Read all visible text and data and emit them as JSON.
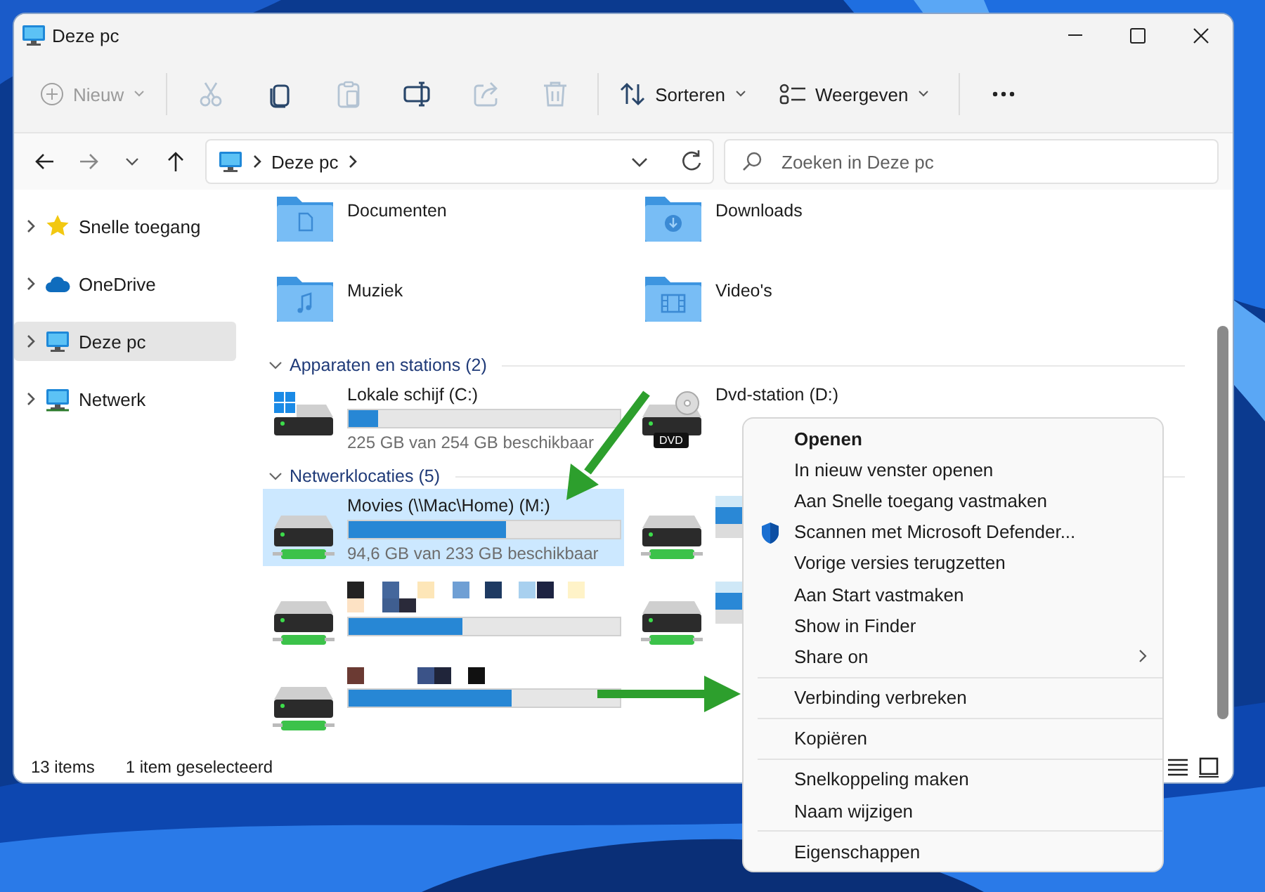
{
  "window": {
    "title": "Deze pc"
  },
  "toolbar": {
    "new": {
      "label": "Nieuw",
      "disabled": true
    },
    "tools": [
      {
        "kind": "cut",
        "disabled": true
      },
      {
        "kind": "copy",
        "disabled": false
      },
      {
        "kind": "paste",
        "disabled": true
      },
      {
        "kind": "rename",
        "disabled": false
      },
      {
        "kind": "share",
        "disabled": true
      },
      {
        "kind": "delete",
        "disabled": true
      }
    ],
    "menus": [
      {
        "kind": "sort",
        "label": "Sorteren"
      },
      {
        "kind": "view",
        "label": "Weergeven"
      }
    ]
  },
  "address_bar": {
    "path": [
      "Deze pc"
    ]
  },
  "search": {
    "placeholder": "Zoeken in Deze pc"
  },
  "sidebar": {
    "items": [
      {
        "kind": "star",
        "label": "Snelle toegang",
        "selected": false
      },
      {
        "kind": "cloud",
        "label": "OneDrive",
        "selected": false
      },
      {
        "kind": "pc",
        "label": "Deze pc",
        "selected": true
      },
      {
        "kind": "network",
        "label": "Netwerk",
        "selected": false
      }
    ]
  },
  "folders": [
    {
      "kind": "documents",
      "name": "Documenten"
    },
    {
      "kind": "downloads",
      "name": "Downloads"
    },
    {
      "kind": "music",
      "name": "Muziek"
    },
    {
      "kind": "videos",
      "name": "Video's"
    }
  ],
  "sections": [
    {
      "title": "Apparaten en stations (2)",
      "expanded": true,
      "items": [
        {
          "kind": "disk",
          "name": "Lokale schijf (C:)",
          "level": 0.11,
          "free": "225 GB van 254 GB beschikbaar",
          "selected": false
        },
        {
          "kind": "dvd",
          "name": "Dvd-station (D:)",
          "badge": "DVD",
          "selected": false
        }
      ]
    },
    {
      "title": "Netwerklocaties (5)",
      "expanded": true,
      "items": [
        {
          "kind": "network",
          "name": "Movies (\\\\Mac\\Home) (M:)",
          "level": 0.58,
          "free": "94,6 GB van 233 GB beschikbaar",
          "selected": true
        },
        {
          "kind": "network_redacted",
          "selected": false
        },
        {
          "kind": "network_redacted",
          "level": 0.42,
          "selected": false
        },
        {
          "kind": "network_redacted",
          "selected": false
        },
        {
          "kind": "network_redacted",
          "level": 0.6,
          "selected": false
        }
      ]
    }
  ],
  "status_bar": {
    "count": "13 items",
    "selection": "1 item geselecteerd"
  },
  "context_menu": {
    "groups": [
      [
        {
          "kind": "default",
          "label": "Openen"
        },
        {
          "kind": "plain",
          "label": "In nieuw venster openen"
        },
        {
          "kind": "plain",
          "label": "Aan Snelle toegang vastmaken"
        },
        {
          "kind": "shield",
          "label": "Scannen met Microsoft Defender..."
        },
        {
          "kind": "plain",
          "label": "Vorige versies terugzetten"
        },
        {
          "kind": "plain",
          "label": "Aan Start vastmaken"
        },
        {
          "kind": "plain",
          "label": "Show in Finder"
        },
        {
          "kind": "submenu",
          "label": "Share on"
        }
      ],
      [
        {
          "kind": "plain",
          "label": "Verbinding verbreken"
        }
      ],
      [
        {
          "kind": "plain",
          "label": "Kopiëren"
        }
      ],
      [
        {
          "kind": "plain",
          "label": "Snelkoppeling maken"
        },
        {
          "kind": "plain",
          "label": "Naam wijzigen"
        }
      ],
      [
        {
          "kind": "plain",
          "label": "Eigenschappen"
        }
      ]
    ]
  },
  "annotations": [
    {
      "kind": "arrow",
      "color": "#2d9f2d"
    },
    {
      "kind": "arrow",
      "color": "#2d9f2d"
    }
  ]
}
